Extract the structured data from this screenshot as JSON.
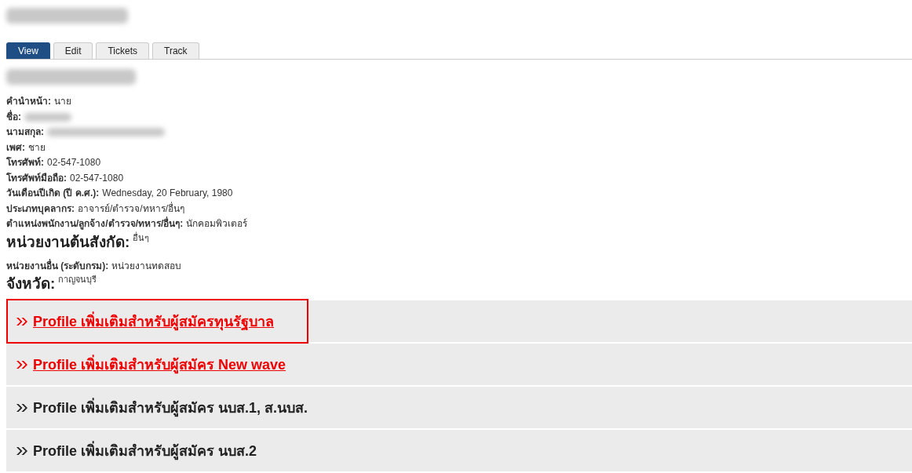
{
  "page_title": {
    "redacted": true
  },
  "tabs": [
    {
      "label": "View",
      "selected": true
    },
    {
      "label": "Edit",
      "selected": false
    },
    {
      "label": "Tickets",
      "selected": false
    },
    {
      "label": "Track",
      "selected": false
    }
  ],
  "profile_heading": {
    "redacted": true
  },
  "fields": [
    {
      "kind": "small",
      "label": "คำนำหน้า:",
      "value": "นาย"
    },
    {
      "kind": "small",
      "label": "ชื่อ:",
      "redacted": true
    },
    {
      "kind": "small",
      "label": "นามสกุล:",
      "redacted": true
    },
    {
      "kind": "small",
      "label": "เพศ:",
      "value": "ชาย"
    },
    {
      "kind": "small",
      "label": "โทรศัพท์:",
      "value": "02-547-1080"
    },
    {
      "kind": "small",
      "label": "โทรศัพท์มือถือ:",
      "value": "02-547-1080"
    },
    {
      "kind": "small",
      "label": "วันเดือนปีเกิด (ปี ค.ศ.):",
      "value": "Wednesday, 20 February, 1980"
    },
    {
      "kind": "small",
      "label": "ประเภทบุคลากร:",
      "value": "อาจารย์/ตำรวจ/ทหาร/อื่นๆ"
    },
    {
      "kind": "small",
      "label": "ตำแหน่งพนักงาน/ลูกจ้าง/ตำรวจ/ทหาร/อื่นๆ:",
      "value": "นักคอมพิวเตอร์"
    },
    {
      "kind": "large",
      "label": "หน่วยงานต้นสังกัด:",
      "value": "อื่นๆ"
    },
    {
      "kind": "small",
      "label": "หน่วยงานอื่น (ระดับกรม):",
      "value": "หน่วยงานทดสอบ"
    },
    {
      "kind": "large",
      "label": "จังหวัด:",
      "value": "กาญจนบุรี"
    }
  ],
  "sections": [
    {
      "label": "Profile เพิ่มเติมสำหรับผู้สมัครทุนรัฐบาล",
      "highlighted": true,
      "outlined": true
    },
    {
      "label": "Profile เพิ่มเติมสำหรับผู้สมัคร New wave",
      "highlighted": true,
      "outlined": false
    },
    {
      "label": "Profile เพิ่มเติมสำหรับผู้สมัคร นบส.1, ส.นบส.",
      "highlighted": false,
      "outlined": false
    },
    {
      "label": "Profile เพิ่มเติมสำหรับผู้สมัคร นบส.2",
      "highlighted": false,
      "outlined": false
    }
  ]
}
